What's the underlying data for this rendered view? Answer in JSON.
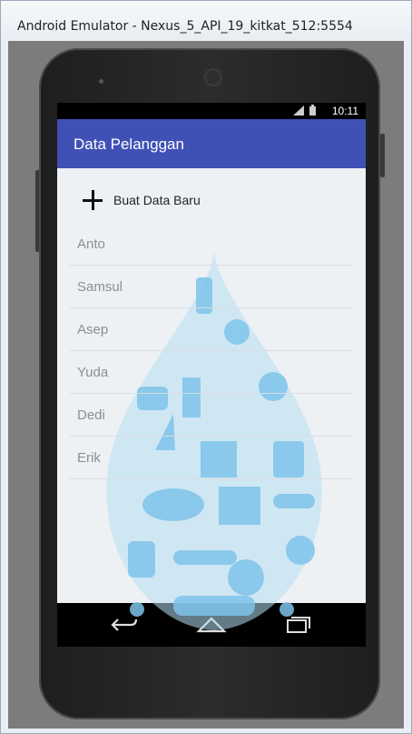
{
  "window": {
    "title": "Android Emulator - Nexus_5_API_19_kitkat_512:5554"
  },
  "status_bar": {
    "time": "10:11",
    "icons": [
      "signal-icon",
      "battery-icon"
    ]
  },
  "app_bar": {
    "title": "Data Pelanggan"
  },
  "add_button": {
    "label": "Buat Data Baru"
  },
  "customers": [
    "Anto",
    "Samsul",
    "Asep",
    "Yuda",
    "Dedi",
    "Erik"
  ],
  "nav_bar": {
    "buttons": [
      "back-icon",
      "home-icon",
      "recent-apps-icon"
    ]
  },
  "colors": {
    "app_bar": "#3f51b5",
    "drop_art": "#9fd3ef"
  }
}
